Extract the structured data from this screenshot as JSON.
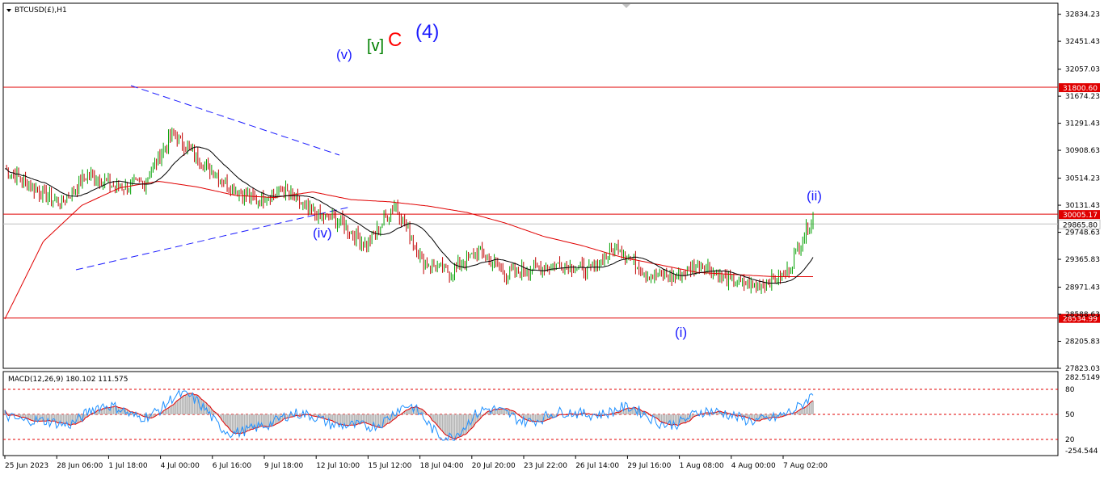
{
  "symbol": {
    "text": "BTCUSD(£),H1"
  },
  "main_panel": {
    "y_range": [
      27823.03,
      32990.0
    ],
    "y_ticks": [
      "32834.23",
      "32451.43",
      "32057.03",
      "31674.23",
      "31291.43",
      "30908.63",
      "30514.23",
      "30131.43",
      "29748.63",
      "29365.83",
      "28971.43",
      "28588.63",
      "28205.83",
      "27823.03"
    ],
    "price_levels": [
      {
        "value": 31800.6,
        "label": "31800.60",
        "color": "#e00000"
      },
      {
        "value": 30005.17,
        "label": "30005.17",
        "color": "#e00000"
      },
      {
        "value": 29865.8,
        "label": "29865.80",
        "color": "#c0c0c0"
      },
      {
        "value": 28534.99,
        "label": "28534.99",
        "color": "#e00000"
      }
    ]
  },
  "x_labels": [
    "25 Jun 2023",
    "28 Jun 06:00",
    "1 Jul 18:00",
    "4 Jul 00:00",
    "6 Jul 16:00",
    "9 Jul 18:00",
    "12 Jul 10:00",
    "15 Jul 12:00",
    "18 Jul 04:00",
    "20 Jul 20:00",
    "23 Jul 22:00",
    "26 Jul 14:00",
    "29 Jul 16:00",
    "1 Aug 08:00",
    "4 Aug 00:00",
    "7 Aug 02:00"
  ],
  "wave_labels": [
    {
      "text": "(v)",
      "color": "#1a1aff",
      "size": 17
    },
    {
      "text": "[v]",
      "color": "#008000",
      "size": 20
    },
    {
      "text": "C",
      "color": "#ff0000",
      "size": 24
    },
    {
      "text": "(4)",
      "color": "#1a1aff",
      "size": 24
    },
    {
      "text": "(iv)",
      "color": "#1a1aff",
      "size": 17
    },
    {
      "text": "(ii)",
      "color": "#1a1aff",
      "size": 17
    },
    {
      "text": "(i)",
      "color": "#1a1aff",
      "size": 17
    }
  ],
  "macd": {
    "label": "MACD(12,26,9) 180.102 111.575",
    "y_ticks": [
      "282.5149",
      "80",
      "50",
      "20",
      "-254.544"
    ]
  },
  "colors": {
    "candle_up": "#00a000",
    "candle_down": "#c00000",
    "ma_fast": "#000000",
    "ma_slow": "#e00000",
    "signal": "#e00000",
    "macd_line": "#1e90ff",
    "histogram": "#b4b4b4",
    "trendline": "#1a1aff"
  },
  "chart_data": {
    "type": "candlestick",
    "symbol": "BTCUSD(£),H1",
    "x_categories": [
      "25 Jun 2023",
      "28 Jun 06:00",
      "1 Jul 18:00",
      "4 Jul 00:00",
      "6 Jul 16:00",
      "9 Jul 18:00",
      "12 Jul 10:00",
      "15 Jul 12:00",
      "18 Jul 04:00",
      "20 Jul 20:00",
      "23 Jul 22:00",
      "26 Jul 14:00",
      "29 Jul 16:00",
      "1 Aug 08:00",
      "4 Aug 00:00",
      "7 Aug 02:00"
    ],
    "close_path": [
      30650,
      30380,
      30150,
      30580,
      30380,
      30440,
      31150,
      30760,
      30420,
      30200,
      30350,
      30020,
      29900,
      29560,
      30150,
      29320,
      29180,
      29480,
      29150,
      29250,
      29300,
      29200,
      29560,
      29150,
      29120,
      29300,
      29050,
      29000,
      29130,
      29970
    ],
    "slow_ma_path": [
      28520,
      29620,
      30130,
      30380,
      30470,
      30390,
      30270,
      30240,
      30320,
      30210,
      30180,
      30120,
      30030,
      29880,
      29690,
      29560,
      29400,
      29290,
      29180,
      29150,
      29120,
      29120
    ],
    "y_range": [
      27823.03,
      32990.0
    ],
    "macd_y_range": [
      -254.544,
      282.5149
    ]
  }
}
